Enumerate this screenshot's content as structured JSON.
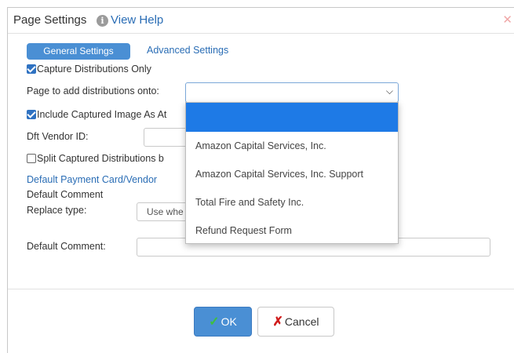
{
  "dialog": {
    "title": "Page Settings",
    "help_link": "View Help",
    "info_icon": "info-circle-icon",
    "close_icon": "close-icon"
  },
  "tabs": [
    {
      "label": "General Settings",
      "active": true
    },
    {
      "label": "Advanced Settings",
      "active": false
    }
  ],
  "form": {
    "capture_only": {
      "label": "Capture Distributions Only",
      "checked": true
    },
    "page_select": {
      "label": "Page to add distributions onto:",
      "value": ""
    },
    "include_image": {
      "label": "Include Captured Image As At",
      "checked": true
    },
    "vendor_id": {
      "label": "Dft Vendor ID:",
      "value": ""
    },
    "split": {
      "label": "Split Captured Distributions b",
      "checked": false
    },
    "payment_link": "Default Payment Card/Vendor",
    "default_comment_header": "Default Comment",
    "replace_type": {
      "label": "Replace type:",
      "value": "Use whe"
    },
    "default_comment": {
      "label": "Default Comment:",
      "value": ""
    }
  },
  "dropdown_options": [
    "",
    "Amazon Capital Services, Inc.",
    "Amazon Capital Services, Inc. Support",
    "Total Fire and Safety Inc.",
    "Refund Request Form"
  ],
  "buttons": {
    "ok": "OK",
    "cancel": "Cancel"
  },
  "colors": {
    "accent": "#4a8fd4",
    "link": "#2a6db5",
    "selected_option": "#1e7ae6"
  }
}
